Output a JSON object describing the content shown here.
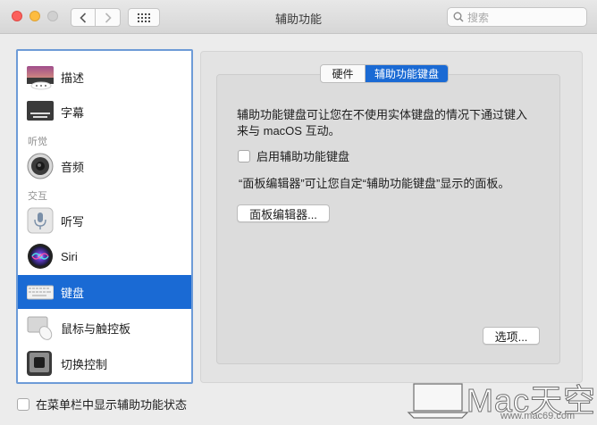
{
  "window": {
    "title": "辅助功能"
  },
  "search": {
    "placeholder": "搜索"
  },
  "sidebar": {
    "items": [
      {
        "label": "描述",
        "icon": "description-icon"
      },
      {
        "label": "字幕",
        "icon": "captions-icon"
      },
      {
        "header": "听觉"
      },
      {
        "label": "音频",
        "icon": "speaker-icon"
      },
      {
        "header": "交互"
      },
      {
        "label": "听写",
        "icon": "microphone-icon"
      },
      {
        "label": "Siri",
        "icon": "siri-icon"
      },
      {
        "label": "键盘",
        "icon": "keyboard-icon",
        "selected": true
      },
      {
        "label": "鼠标与触控板",
        "icon": "mouse-trackpad-icon"
      },
      {
        "label": "切换控制",
        "icon": "switch-control-icon"
      }
    ]
  },
  "tabs": [
    {
      "label": "硬件",
      "active": false
    },
    {
      "label": "辅助功能键盘",
      "active": true
    }
  ],
  "content": {
    "description_line1": "辅助功能键盘可让您在不使用实体键盘的情况下通过键入",
    "description_line2": "来与 macOS 互动。",
    "enable_checkbox_label": "启用辅助功能键盘",
    "enable_checked": false,
    "panel_editor_text": "“面板编辑器”可让您自定“辅助功能键盘”显示的面板。",
    "panel_editor_button": "面板编辑器...",
    "options_button": "选项..."
  },
  "footer": {
    "show_status_label": "在菜单栏中显示辅助功能状态",
    "show_status_checked": false
  },
  "watermark": {
    "brand": "Mac天空",
    "url": "www.mac69.com"
  },
  "colors": {
    "accent": "#1a6ad4",
    "sidebar_border": "#6d9bd7"
  }
}
